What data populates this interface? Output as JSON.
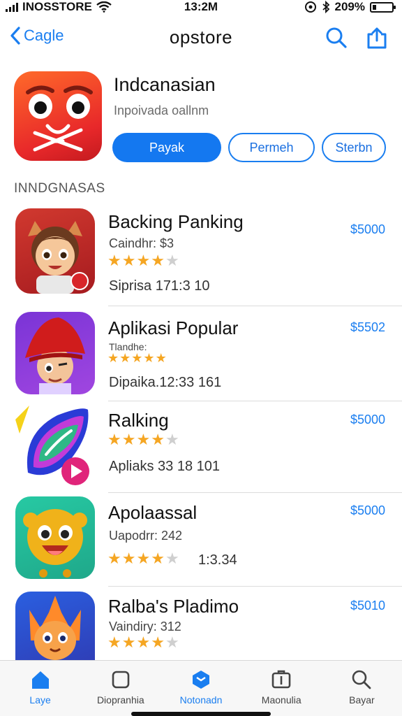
{
  "status": {
    "carrier": "INOSSTORE",
    "time": "13:2M",
    "battery_text": "209%",
    "battery_level": 0.2
  },
  "nav": {
    "back_label": "Cagle",
    "title": "opstore"
  },
  "hero": {
    "name": "Indcanasian",
    "subtitle": "Inpoivada oallnm",
    "buttons": [
      "Payak",
      "Permeh",
      "Sterbn"
    ]
  },
  "section": {
    "label": "INNDGNASAS"
  },
  "apps": [
    {
      "name": "Backing Panking",
      "meta": "Caindhr: $3",
      "rating": 4,
      "detail": "Siprisa 171:3 10",
      "price": "$5000",
      "icon": "character-girl-icon"
    },
    {
      "name": "Aplikasi Popular",
      "meta": "Tlandhe:",
      "rating": 5,
      "detail": "Dipaika.12:33 161",
      "price": "$5502",
      "icon": "character-red-hat-icon"
    },
    {
      "name": "Ralking",
      "meta": "",
      "rating": 4,
      "detail": "Apliaks 33 18 101",
      "price": "$5000",
      "icon": "leaf-play-icon"
    },
    {
      "name": "Apolaassal",
      "meta": "Uapodrr: 242",
      "rating": 4,
      "detail": "1:3.34",
      "price": "$5000",
      "icon": "character-lion-icon"
    },
    {
      "name": "Ralba's Pladimo",
      "meta": "Vaindiry: 312",
      "rating": 4,
      "detail": "",
      "price": "$5010",
      "icon": "character-fox-icon"
    }
  ],
  "tabs": [
    {
      "label": "Laye",
      "icon": "home-icon",
      "active": true
    },
    {
      "label": "Diopranhia",
      "icon": "square-icon",
      "active": false
    },
    {
      "label": "Notonadn",
      "icon": "layers-icon",
      "active": true
    },
    {
      "label": "Maonulia",
      "icon": "apps-box-icon",
      "active": false
    },
    {
      "label": "Bayar",
      "icon": "search-icon",
      "active": false
    }
  ],
  "colors": {
    "accent": "#1a7ef0",
    "star": "#f5a623",
    "hero_icon": "#e8282a"
  }
}
